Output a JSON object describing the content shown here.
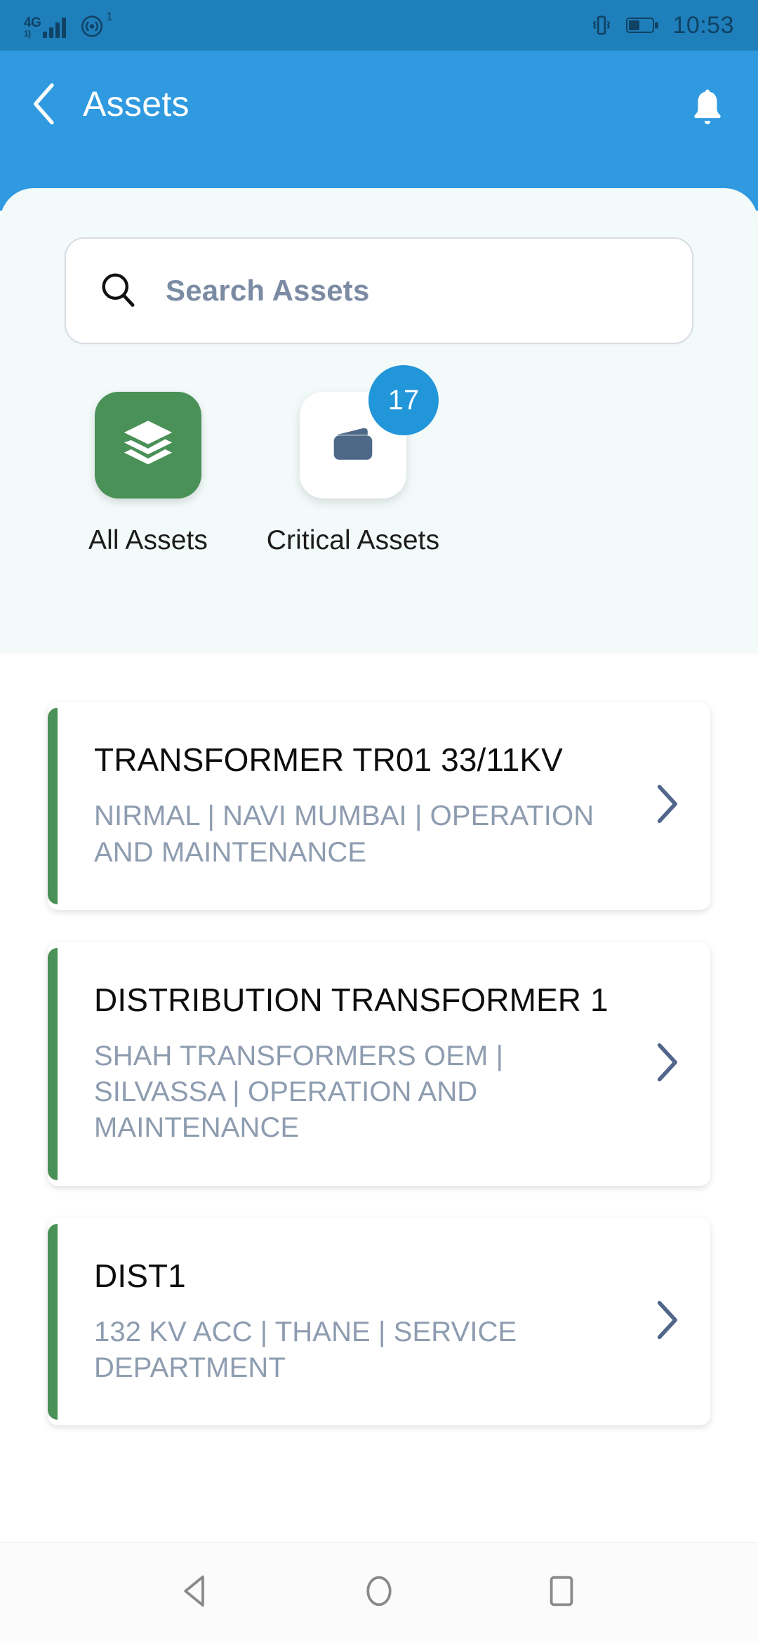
{
  "statusbar": {
    "network_label": "4G",
    "network_sub": "1)",
    "hotspot_superscript": "1",
    "signal_icon": "signal-bars-icon",
    "hotspot_icon": "hotspot-icon",
    "vibrate_icon": "vibrate-icon",
    "battery_icon": "battery-icon",
    "time": "10:53"
  },
  "appbar": {
    "back_icon": "back-chevron-icon",
    "title": "Assets",
    "bell_icon": "bell-icon"
  },
  "search": {
    "icon": "search-icon",
    "placeholder": "Search Assets",
    "value": ""
  },
  "tiles": [
    {
      "id": "all-assets",
      "label": "All Assets",
      "icon": "layers-icon",
      "style": "green",
      "badge": null
    },
    {
      "id": "critical-assets",
      "label": "Critical Assets",
      "icon": "wallet-icon",
      "style": "white",
      "badge": "17"
    }
  ],
  "assets": [
    {
      "title": "TRANSFORMER TR01 33/11KV",
      "subtitle": "NIRMAL | NAVI MUMBAI | OPERATION AND MAINTENANCE",
      "accent": "#4a9158",
      "chevron": "chevron-right-icon"
    },
    {
      "title": "DISTRIBUTION TRANSFORMER 1",
      "subtitle": "SHAH TRANSFORMERS OEM | SILVASSA | OPERATION AND MAINTENANCE",
      "accent": "#4a9158",
      "chevron": "chevron-right-icon"
    },
    {
      "title": "DIST1",
      "subtitle": "132 KV ACC | THANE | SERVICE DEPARTMENT",
      "accent": "#4a9158",
      "chevron": "chevron-right-icon"
    }
  ],
  "navbar": {
    "back_icon": "nav-back-triangle-icon",
    "home_icon": "nav-home-circle-icon",
    "recents_icon": "nav-recents-square-icon"
  },
  "colors": {
    "statusbar_blue": "#1f7fba",
    "appbar_blue": "#2f9ae0",
    "panel_bg": "#f3fafa",
    "accent_green": "#4a9158",
    "badge_blue": "#2196d9",
    "wallet_slate": "#4e6887",
    "chevron_slate": "#52668c",
    "subtitle_gray": "#8e9cb0",
    "placeholder_gray": "#7b8ba3"
  }
}
